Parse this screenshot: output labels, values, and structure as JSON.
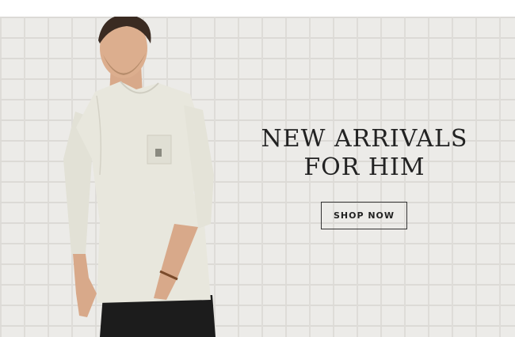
{
  "hero": {
    "headline_line1": "NEW ARRIVALS",
    "headline_line2": "FOR HIM",
    "cta_label": "SHOP NOW"
  },
  "colors": {
    "wall": "#ecebe8",
    "mortar": "#dcdad6",
    "text": "#222222",
    "sweater": "#e8e7dd",
    "pants": "#1c1c1c"
  }
}
